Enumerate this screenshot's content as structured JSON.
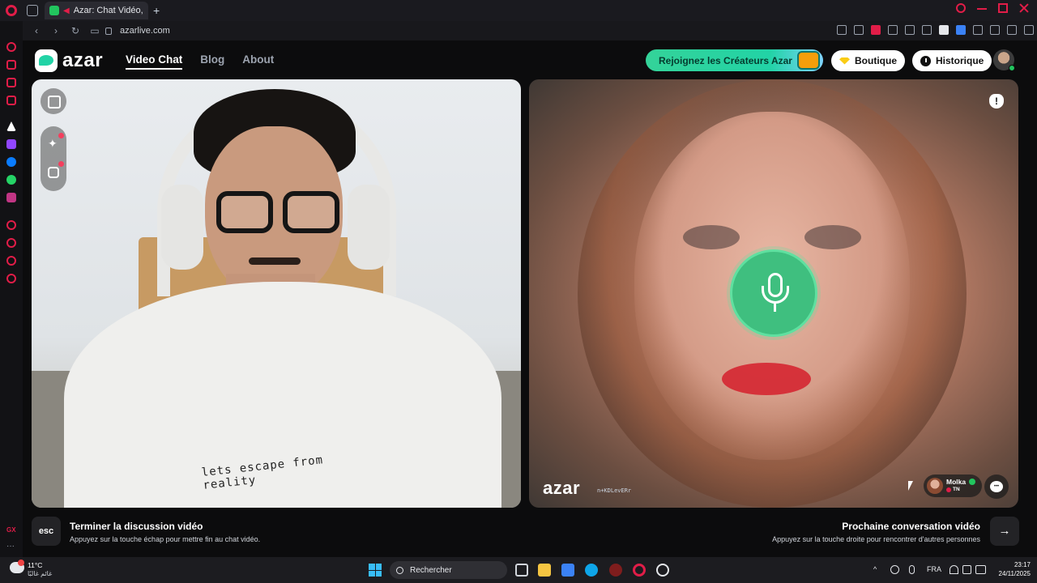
{
  "browser": {
    "tab_title": "Azar: Chat Vidéo, Ren",
    "url": "azarlive.com"
  },
  "header": {
    "logo_text": "azar",
    "nav": [
      {
        "label": "Video Chat",
        "active": true
      },
      {
        "label": "Blog",
        "active": false
      },
      {
        "label": "About",
        "active": false
      }
    ],
    "creators_button": "Rejoignez les Créateurs Azar",
    "shop_button": "Boutique",
    "history_button": "Historique"
  },
  "remote_video": {
    "watermark": "azar",
    "watermark_id": "n+KDLevERr",
    "partner_name": "Molka",
    "partner_country": "TN"
  },
  "local_video": {
    "hoodie_print": "lets escape from reality"
  },
  "footer": {
    "esc_key": "esc",
    "end_title": "Terminer la discussion vidéo",
    "end_sub": "Appuyez sur la touche échap pour mettre fin au chat vidéo.",
    "next_key": "→",
    "next_title": "Prochaine conversation vidéo",
    "next_sub": "Appuyez sur la touche droite pour rencontrer d'autres personnes"
  },
  "taskbar": {
    "weather_temp": "11°C",
    "weather_desc": "غائم غالبًا",
    "search_placeholder": "Rechercher",
    "language": "FRA",
    "time": "23:17",
    "date": "24/11/2025"
  },
  "colors": {
    "accent": "#3fbf7f",
    "opera_red": "#e11d48",
    "creators_gradient_start": "#34d399"
  }
}
